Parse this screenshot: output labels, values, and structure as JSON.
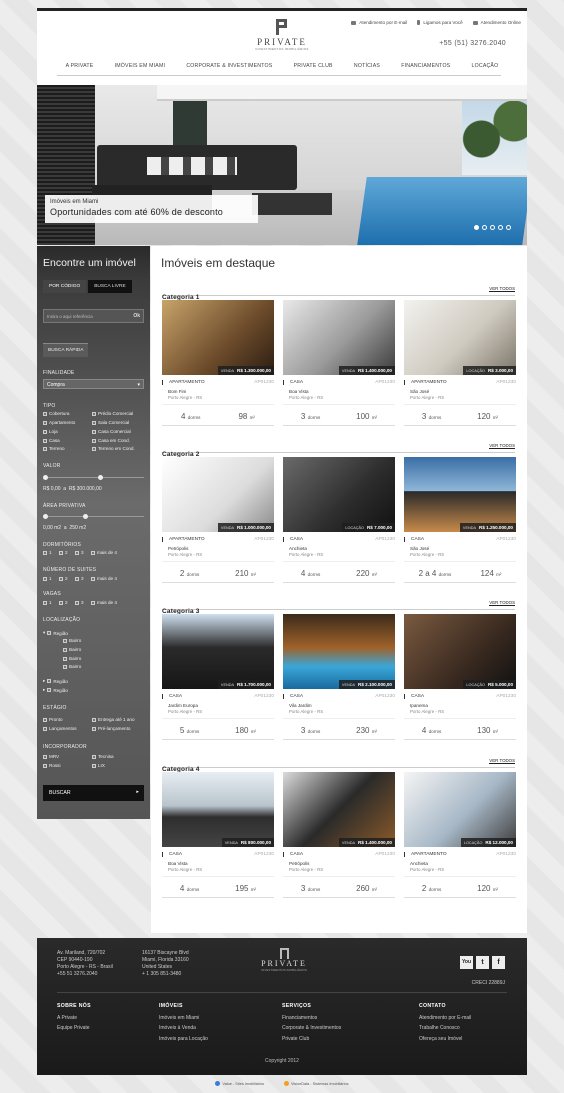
{
  "brand": {
    "name": "PRIVATE",
    "tagline": "INVESTIMENTOS IMOBILIÁRIOS"
  },
  "header": {
    "links": [
      {
        "icon": "mail-icon",
        "label": "Atendimento por E-mail"
      },
      {
        "icon": "phone-icon",
        "label": "Ligamos para Você"
      },
      {
        "icon": "chat-icon",
        "label": "Atendimento Online"
      }
    ],
    "phone": "+55 (51) 3276.2040"
  },
  "nav": [
    "A PRIVATE",
    "IMÓVEIS EM MIAMI",
    "CORPORATE & INVESTIMENTOS",
    "PRIVATE CLUB",
    "NOTÍCIAS",
    "FINANCIAMENTOS",
    "LOCAÇÃO"
  ],
  "hero": {
    "line1": "Imóveis em Miami",
    "line2": "Oportunidades com até 60% de desconto",
    "slides": 5,
    "active": 1
  },
  "search": {
    "title": "Encontre um imóvel",
    "tabs": [
      "POR CÓDIGO",
      "BUSCA LIVRE"
    ],
    "ref_placeholder": "Insira o aqui referência",
    "ok": "Ok",
    "busca_rapida": "BUSCA RÁPIDA",
    "finalidade_label": "FINALIDADE",
    "finalidade_value": "Compra",
    "tipo_label": "TIPO",
    "tipos": [
      "Cobertura",
      "Prédio Comercial",
      "Apartamento",
      "Sala Comercial",
      "Loja",
      "Casa Comercial",
      "Casa",
      "Casa em Cond.",
      "Terreno",
      "Terreno em Cond."
    ],
    "valor_label": "VALOR",
    "valor_min": "R$  0,00",
    "valor_sep": "a",
    "valor_max": "R$  300.000,00",
    "area_label": "ÁREA PRIVATIVA",
    "area_min": "0,00 m2",
    "area_sep": "a",
    "area_max": "250 m2",
    "dorm_label": "DORMITÓRIOS",
    "suites_label": "NÚMERO DE SUITES",
    "vagas_label": "VAGAS",
    "qty": [
      "1",
      "2",
      "3",
      "mais de 4"
    ],
    "loc_label": "LOCALIZAÇÃO",
    "locs": [
      "Região",
      "Bairro",
      "Bairro",
      "Bairro",
      "Bairro",
      "Região",
      "Região"
    ],
    "estagio_label": "ESTÁGIO",
    "estagios": [
      "Pronto",
      "Entrega até 1 ano",
      "Lançamentos",
      "Pré-lançamento"
    ],
    "inc_label": "INCORPORADOR",
    "incs": [
      "MRV",
      "Tecnisa",
      "Rossi",
      "LIX"
    ],
    "buscar": "BUSCAR"
  },
  "main": {
    "title": "Imóveis em destaque",
    "ver_todos": "VER TODOS"
  },
  "categories": [
    {
      "name": "Categoria 1",
      "cards": [
        {
          "tag": "VENDA",
          "price": "R$ 1.300.000,00",
          "type": "APARTAMENTO",
          "code": "AP01230",
          "bairro": "Bom Fim",
          "city": "Porto Alegre - RS",
          "dorms": "4",
          "dlabel": "dorms",
          "area": "98",
          "unit": "m²"
        },
        {
          "tag": "VENDA",
          "price": "R$ 1.400.000,00",
          "type": "CASA",
          "code": "AP01230",
          "bairro": "Boa Vista",
          "city": "Porto Alegre - RS",
          "dorms": "3",
          "dlabel": "dorms",
          "area": "100",
          "unit": "m²"
        },
        {
          "tag": "LOCAÇÃO",
          "price": "R$ 3.000,00",
          "type": "APARTAMENTO",
          "code": "AP01230",
          "bairro": "São José",
          "city": "Porto Alegre - RS",
          "dorms": "3",
          "dlabel": "dorms",
          "area": "120",
          "unit": "m²"
        }
      ]
    },
    {
      "name": "Categoria 2",
      "cards": [
        {
          "tag": "VENDA",
          "price": "R$ 1.000.000,00",
          "type": "APARTAMENTO",
          "code": "AP01230",
          "bairro": "Petrópolis",
          "city": "Porto Alegre - RS",
          "dorms": "2",
          "dlabel": "dorms",
          "area": "210",
          "unit": "m²"
        },
        {
          "tag": "LOCAÇÃO",
          "price": "R$ 7.000,00",
          "type": "CASA",
          "code": "AP01230",
          "bairro": "Anchieta",
          "city": "Porto Alegre - RS",
          "dorms": "4",
          "dlabel": "dorms",
          "area": "220",
          "unit": "m²"
        },
        {
          "tag": "VENDA",
          "price": "R$ 1.250.000,00",
          "type": "CASA",
          "code": "AP01230",
          "bairro": "São José",
          "city": "Porto Alegre - RS",
          "dorms": "2 a 4",
          "dlabel": "dorms",
          "area": "124",
          "unit": "m²"
        }
      ]
    },
    {
      "name": "Categoria 3",
      "cards": [
        {
          "tag": "VENDA",
          "price": "R$ 1.700.000,00",
          "type": "CASA",
          "code": "AP01230",
          "bairro": "Jardim Europa",
          "city": "Porto Alegre - RS",
          "dorms": "5",
          "dlabel": "dorms",
          "area": "180",
          "unit": "m²"
        },
        {
          "tag": "VENDA",
          "price": "R$ 2.100.000,00",
          "type": "CASA",
          "code": "AP01230",
          "bairro": "Vila Jardim",
          "city": "Porto Alegre - RS",
          "dorms": "3",
          "dlabel": "dorms",
          "area": "230",
          "unit": "m²"
        },
        {
          "tag": "LOCAÇÃO",
          "price": "R$ 5.000,00",
          "type": "CASA",
          "code": "AP01230",
          "bairro": "Ipanema",
          "city": "Porto Alegre - RS",
          "dorms": "4",
          "dlabel": "dorms",
          "area": "130",
          "unit": "m²"
        }
      ]
    },
    {
      "name": "Categoria 4",
      "cards": [
        {
          "tag": "VENDA",
          "price": "R$ 800.000,00",
          "type": "CASA",
          "code": "AP01230",
          "bairro": "Boa Vista",
          "city": "Porto Alegre - RS",
          "dorms": "4",
          "dlabel": "dorms",
          "area": "195",
          "unit": "m²"
        },
        {
          "tag": "VENDA",
          "price": "R$ 1.400.000,00",
          "type": "CASA",
          "code": "AP01230",
          "bairro": "Petrópolis",
          "city": "Porto Alegre - RS",
          "dorms": "3",
          "dlabel": "dorms",
          "area": "260",
          "unit": "m²"
        },
        {
          "tag": "LOCAÇÃO",
          "price": "R$ 12.000,00",
          "type": "APARTAMENTO",
          "code": "AP01230",
          "bairro": "Anchieta",
          "city": "Porto Alegre - RS",
          "dorms": "2",
          "dlabel": "dorms",
          "area": "120",
          "unit": "m²"
        }
      ]
    }
  ],
  "footer": {
    "addr1": [
      "Av. Mariland, 720/702",
      "CEP 90440-190",
      "Porto Alegre - RS - Brasil",
      "+55 51 3276.2040"
    ],
    "addr2": [
      "16137 Biscayne Blvd",
      "Miami, Florida 33160",
      "United States",
      "+ 1 305 851-3480"
    ],
    "social": [
      "You",
      "t",
      "f"
    ],
    "creci": "CRECI  22889J",
    "cols": [
      {
        "title": "SOBRE NÓS",
        "items": [
          "A Private",
          "Equipe Private"
        ]
      },
      {
        "title": "IMÓVEIS",
        "items": [
          "Imóveis em Miami",
          "Imóveis à Venda",
          "Imóveis para Locação"
        ]
      },
      {
        "title": "SERVIÇOS",
        "items": [
          "Financiamentos",
          "Corporate & Investimentos",
          "Private Club"
        ]
      },
      {
        "title": "CONTATO",
        "items": [
          "Atendimento por E-mail",
          "Trabalhe Conosco",
          "Ofereça seu Imóvel"
        ]
      }
    ],
    "copyright": "Copyright 2012"
  },
  "credits": [
    "Value - Sites Imobiliários",
    "VisionData - Sistemas Imobiliários"
  ],
  "colors": {
    "accent": "#222222",
    "pool": "#2f86c4",
    "sidebar": "#3b3b3b",
    "footer": "#1e1e1e"
  }
}
